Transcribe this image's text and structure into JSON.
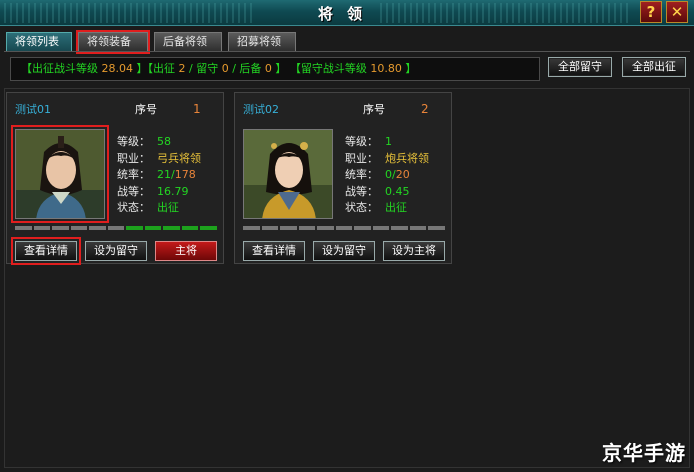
{
  "window": {
    "title": "将领",
    "help_label": "?",
    "close_label": "✕"
  },
  "tabs": [
    {
      "label": "将领列表"
    },
    {
      "label": "将领装备"
    },
    {
      "label": "后备将领"
    },
    {
      "label": "招募将领"
    }
  ],
  "status": {
    "p1": "【出征战斗等级 ",
    "lv_out": "28.04",
    "p2": " 】【出征 ",
    "out": "2",
    "p3": " / 留守 ",
    "stay": "0",
    "p4": " / 后备 ",
    "reserve": "0",
    "p5": " 】  【留守战斗等级 ",
    "lv_stay": "10.80",
    "p6": " 】"
  },
  "buttons": {
    "all_stay": "全部留守",
    "all_out": "全部出征"
  },
  "generals": [
    {
      "name": "测试01",
      "seq_label": "序号",
      "seq": "1",
      "level_label": "等级：",
      "level": "58",
      "job_label": "职业：",
      "job": "弓兵将领",
      "lead_label": "统率：",
      "lead_cur": "21",
      "lead_sep": "/",
      "lead_max": "178",
      "combat_label": "战等：",
      "combat": "16.79",
      "state_label": "状态：",
      "state": "出征",
      "btn_detail": "查看详情",
      "btn_stay": "设为留守",
      "btn_main": "主将"
    },
    {
      "name": "测试02",
      "seq_label": "序号",
      "seq": "2",
      "level_label": "等级：",
      "level": "1",
      "job_label": "职业：",
      "job": "炮兵将领",
      "lead_label": "统率：",
      "lead_cur": "0",
      "lead_sep": "/",
      "lead_max": "20",
      "combat_label": "战等：",
      "combat": "0.45",
      "state_label": "状态：",
      "state": "出征",
      "btn_detail": "查看详情",
      "btn_stay": "设为留守",
      "btn_main": "设为主将"
    }
  ],
  "watermark": "京华手游",
  "colors": {
    "accent_green": "#23d623",
    "number_orange": "#e8843a",
    "highlight_red": "#e01e1e"
  }
}
